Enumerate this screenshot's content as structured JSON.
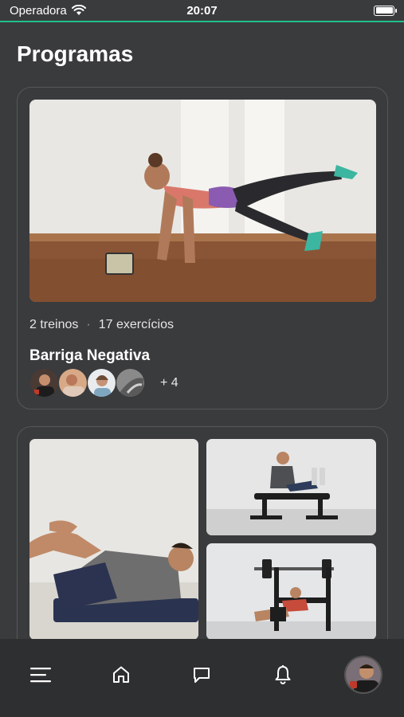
{
  "status_bar": {
    "carrier": "Operadora",
    "time": "20:07"
  },
  "colors": {
    "accent": "#21c08b",
    "background": "#3a3b3d",
    "tab_bar": "#2e2f31"
  },
  "page": {
    "title": "Programas"
  },
  "programs": [
    {
      "workouts": "2 treinos",
      "separator": "·",
      "exercises": "17 exercícios",
      "name": "Barriga Negativa",
      "extra_members": "+ 4"
    }
  ],
  "tab_bar": {
    "items": [
      {
        "icon": "menu-icon"
      },
      {
        "icon": "home-icon"
      },
      {
        "icon": "chat-icon"
      },
      {
        "icon": "bell-icon"
      },
      {
        "icon": "profile-avatar"
      }
    ]
  }
}
